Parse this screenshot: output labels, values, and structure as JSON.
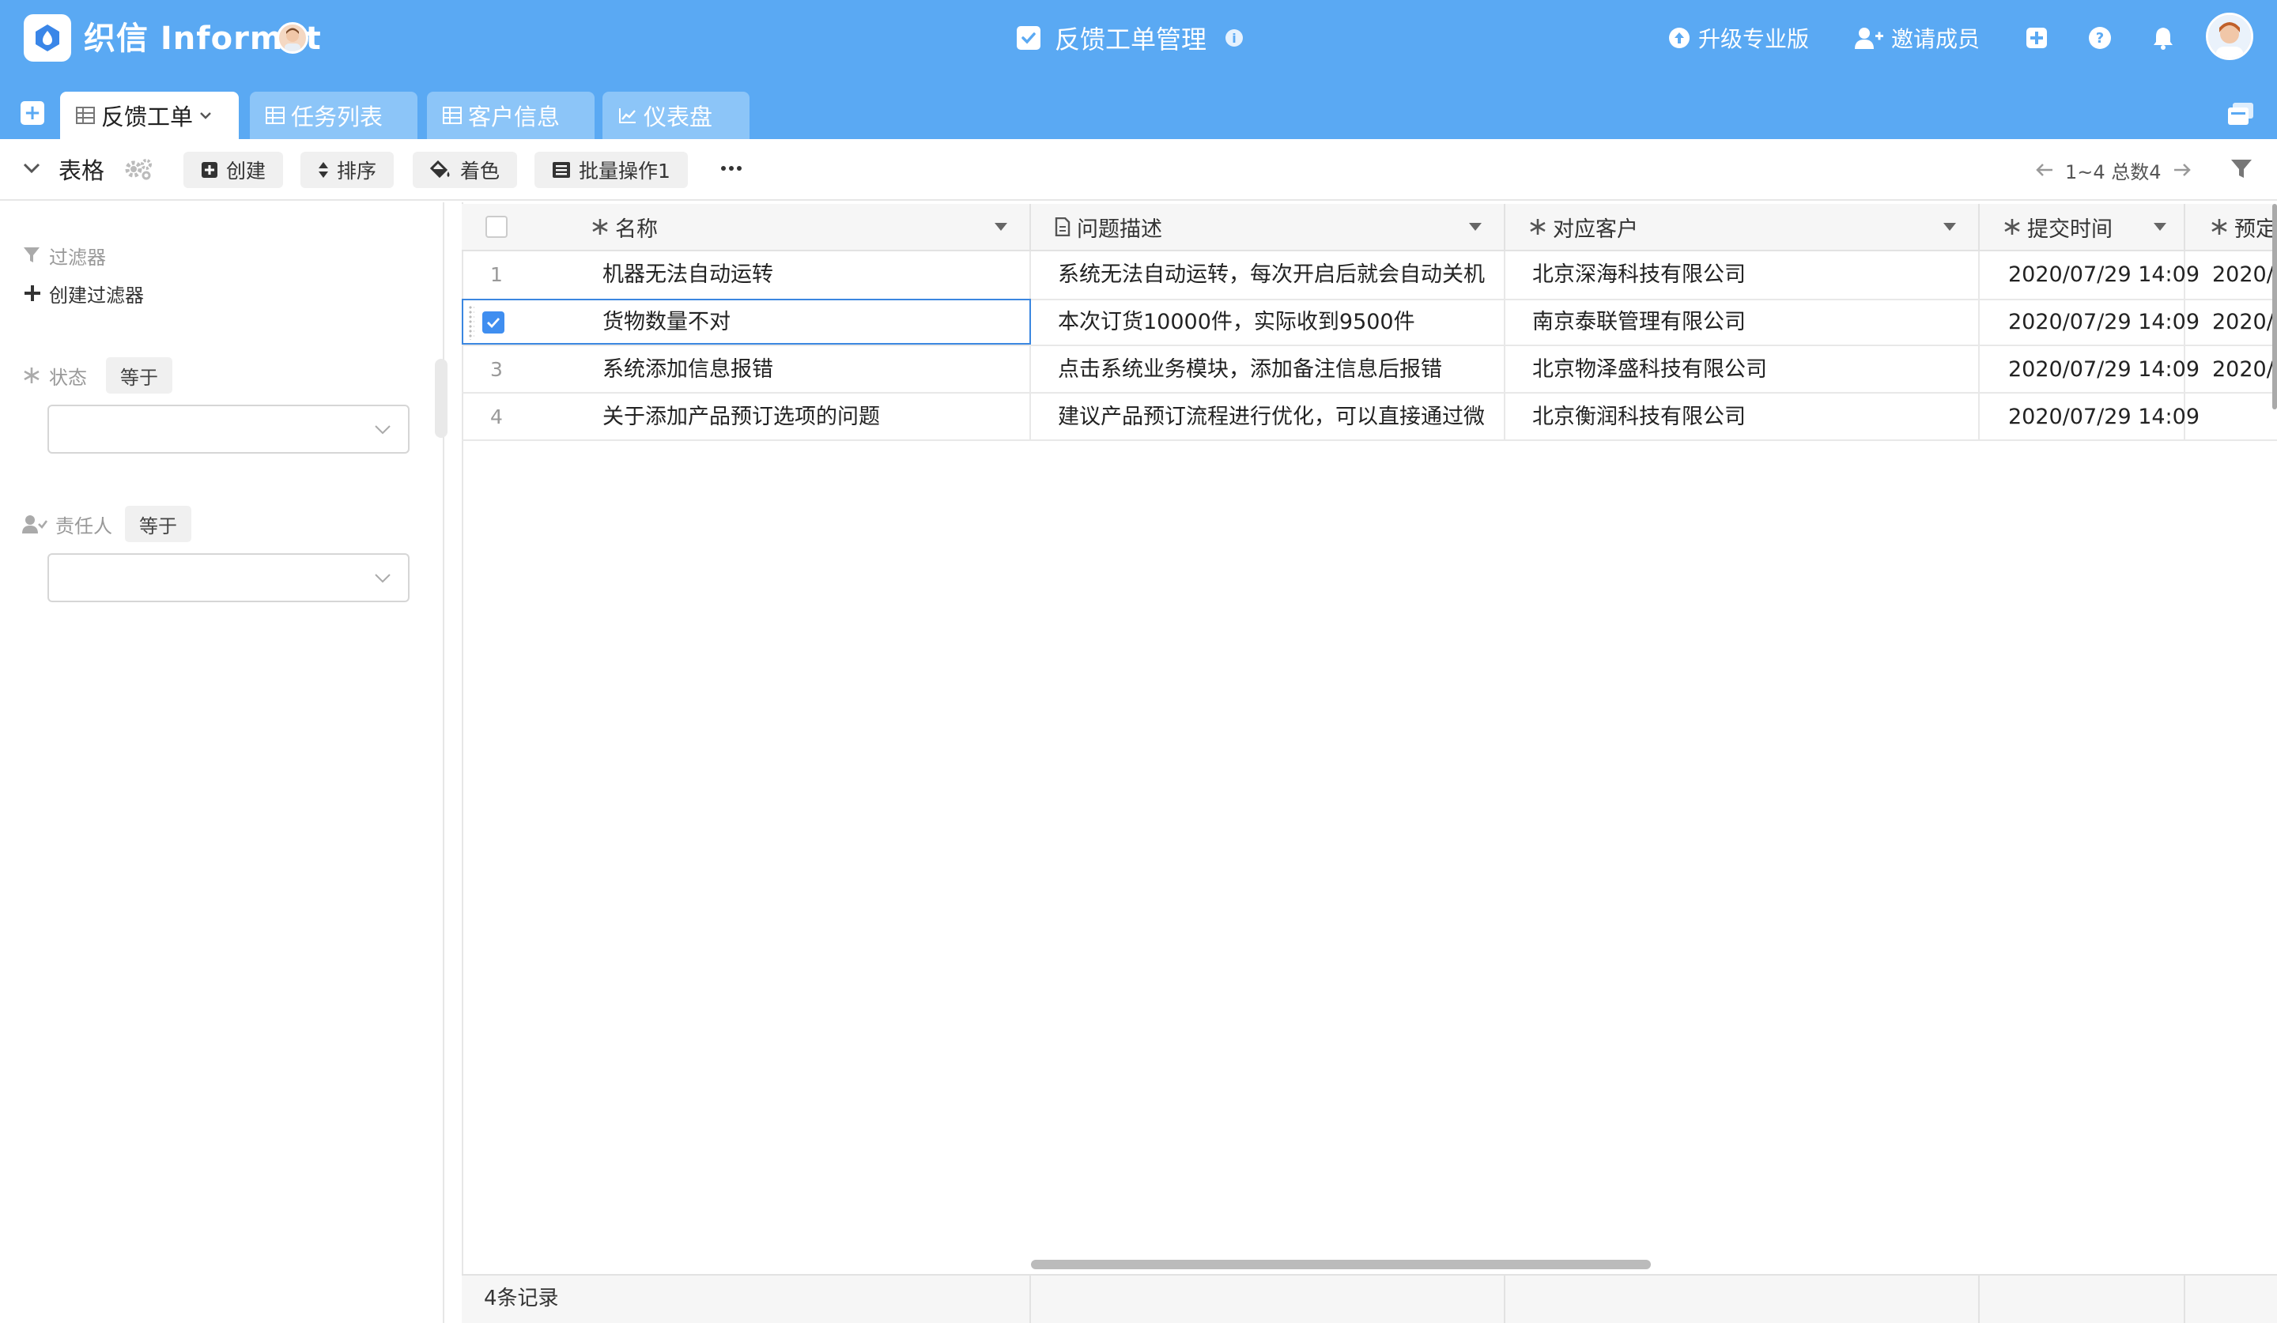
{
  "header": {
    "app_name": "织信 Informat",
    "app_title": "反馈工单管理",
    "upgrade_label": "升级专业版",
    "invite_label": "邀请成员",
    "brand_color": "#5aa9f3"
  },
  "tabs": [
    {
      "label": "反馈工单",
      "icon": "grid-icon",
      "active": true
    },
    {
      "label": "任务列表",
      "icon": "grid-icon",
      "active": false
    },
    {
      "label": "客户信息",
      "icon": "grid-icon",
      "active": false
    },
    {
      "label": "仪表盘",
      "icon": "chart-icon",
      "active": false
    }
  ],
  "toolbar": {
    "view_label": "表格",
    "create_label": "创建",
    "sort_label": "排序",
    "color_label": "着色",
    "batch_label": "批量操作1",
    "pager_text": "1~4 总数4"
  },
  "sidebar": {
    "filter_title": "过滤器",
    "create_filter_label": "创建过滤器",
    "filters": [
      {
        "field": "状态",
        "operator": "等于",
        "value": ""
      },
      {
        "field": "责任人",
        "operator": "等于",
        "value": ""
      }
    ]
  },
  "table": {
    "columns": [
      "名称",
      "问题描述",
      "对应客户",
      "提交时间",
      "预定"
    ],
    "rows": [
      {
        "num": "1",
        "name": "机器无法自动运转",
        "desc": "系统无法自动运转，每次开启后就会自动关机",
        "customer": "北京深海科技有限公司",
        "time": "2020/07/29 14:09",
        "due": "2020/0"
      },
      {
        "num": "",
        "name": "货物数量不对",
        "desc": "本次订货10000件，实际收到9500件",
        "customer": "南京泰联管理有限公司",
        "time": "2020/07/29 14:09",
        "due": "2020/0"
      },
      {
        "num": "3",
        "name": "系统添加信息报错",
        "desc": "点击系统业务模块，添加备注信息后报错",
        "customer": "北京物泽盛科技有限公司",
        "time": "2020/07/29 14:09",
        "due": "2020/0"
      },
      {
        "num": "4",
        "name": "关于添加产品预订选项的问题",
        "desc": "建议产品预订流程进行优化，可以直接通过微信",
        "customer": "北京衡润科技有限公司",
        "time": "2020/07/29 14:09",
        "due": ""
      }
    ],
    "footer_count": "4条记录"
  }
}
